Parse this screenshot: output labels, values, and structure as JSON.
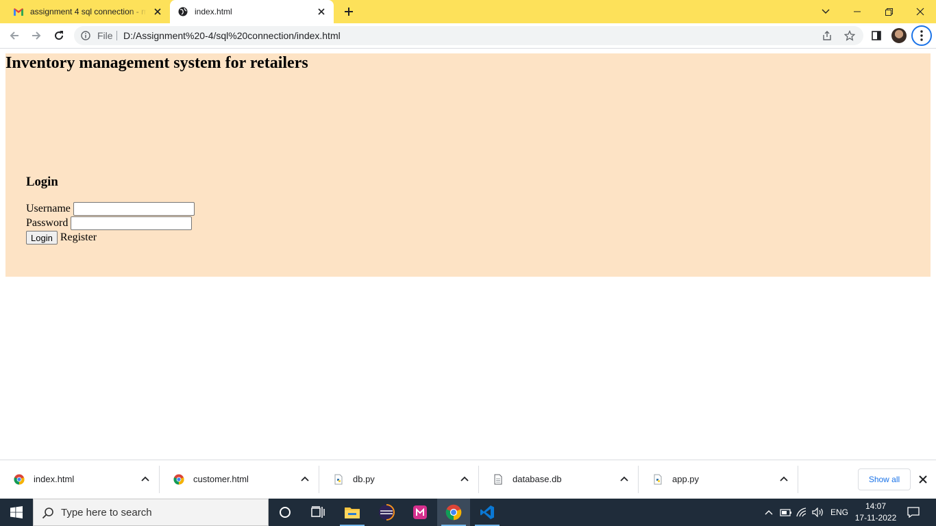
{
  "browser": {
    "tabs": [
      {
        "title": "assignment 4 sql connection - m",
        "favicon": "gmail-icon",
        "active": false
      },
      {
        "title": "index.html",
        "favicon": "globe-icon",
        "active": true
      }
    ],
    "address": {
      "scheme_label": "File",
      "url": "D:/Assignment%20-4/sql%20connection/index.html"
    },
    "accent": "#fde15a"
  },
  "page": {
    "title": "Inventory management system for retailers",
    "background": "#fde3c5",
    "login": {
      "heading": "Login",
      "username_label": "Username",
      "username_value": "",
      "password_label": "Password",
      "password_value": "",
      "login_button": "Login",
      "register_label": "Register"
    }
  },
  "downloads": {
    "items": [
      {
        "name": "index.html",
        "icon": "chrome-icon"
      },
      {
        "name": "customer.html",
        "icon": "chrome-icon"
      },
      {
        "name": "db.py",
        "icon": "python-file-icon"
      },
      {
        "name": "database.db",
        "icon": "file-icon"
      },
      {
        "name": "app.py",
        "icon": "python-file-icon"
      }
    ],
    "show_all": "Show all"
  },
  "taskbar": {
    "search_placeholder": "Type here to search",
    "apps": [
      "cortana-icon",
      "task-view-icon",
      "file-explorer-icon",
      "eclipse-icon",
      "app-icon",
      "chrome-icon",
      "vscode-icon"
    ],
    "language": "ENG",
    "time": "14:07",
    "date": "17-11-2022"
  }
}
